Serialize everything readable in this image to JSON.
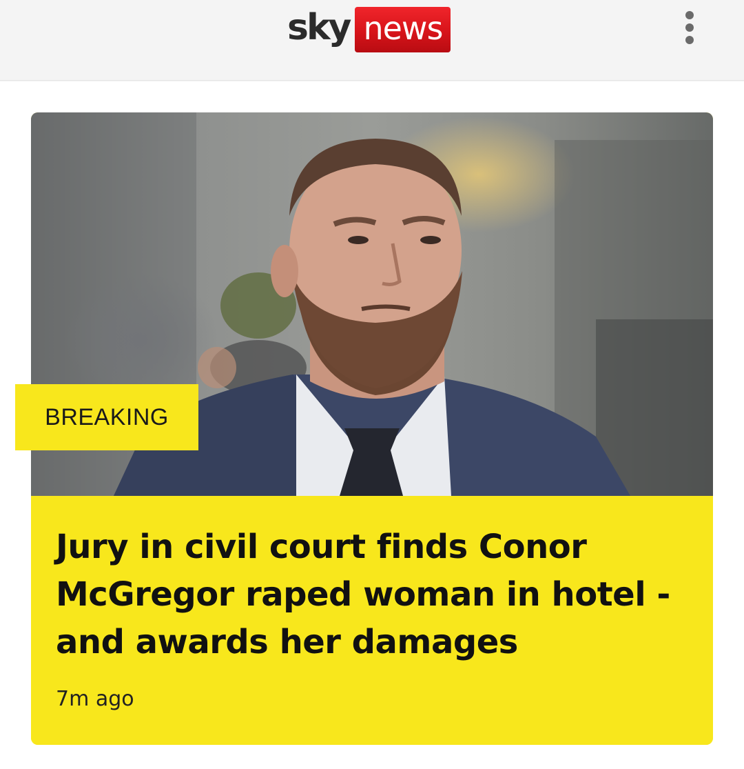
{
  "header": {
    "logo_sky": "sky",
    "logo_news": "news",
    "menu_icon": "more-vertical-icon"
  },
  "article": {
    "badge": "BREAKING",
    "headline": "Jury in civil court finds Conor McGregor raped woman in hotel - and awards her damages",
    "timestamp": "7m ago",
    "image_subject": "man-with-beard-in-suit-photo"
  },
  "colors": {
    "brand_red": "#d7141a",
    "breaking_yellow": "#f8e71c",
    "header_bg": "#f4f4f4",
    "text_dark": "#111111"
  }
}
